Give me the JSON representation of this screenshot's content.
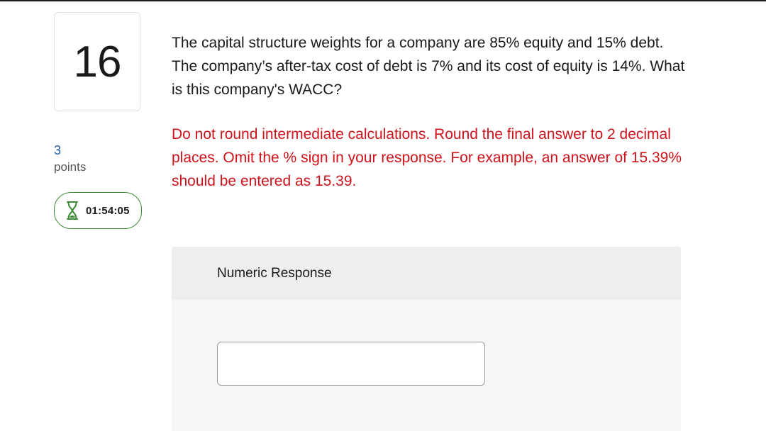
{
  "question": {
    "number": "16",
    "points_value": "3",
    "points_label": "points",
    "timer": "01:54:05",
    "text": "The capital structure weights for a company are 85% equity and 15% debt. The company’s after-tax cost of debt is 7% and its cost of equity is 14%. What is this company's WACC?",
    "instructions": "Do not round intermediate calculations. Round the final answer to 2 decimal places. Omit the % sign in your response. For example, an answer of 15.39% should be entered as 15.39."
  },
  "response": {
    "header": "Numeric Response",
    "input_value": "",
    "input_placeholder": ""
  },
  "icons": {
    "timer_icon": "hourglass-icon"
  },
  "colors": {
    "instructions": "#d0121b",
    "points_value": "#1f5fa8",
    "timer_border": "#3d8b37"
  }
}
